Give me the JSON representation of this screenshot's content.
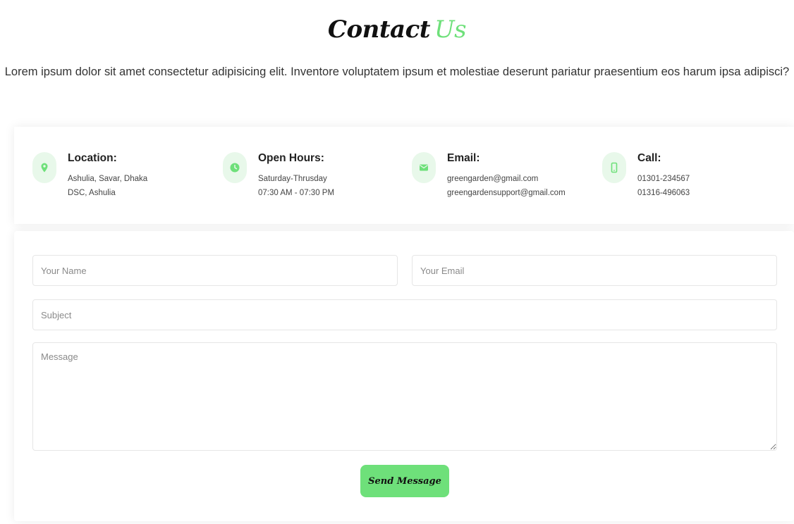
{
  "header": {
    "title_main": "Contact",
    "title_accent": "Us",
    "intro": "Lorem ipsum dolor sit amet consectetur adipisicing elit. Inventore voluptatem ipsum et molestiae deserunt pariatur praesentium eos harum ipsa adipisci?"
  },
  "info": [
    {
      "icon": "map-pin-icon",
      "title": "Location:",
      "lines": [
        "Ashulia, Savar, Dhaka",
        "DSC, Ashulia"
      ]
    },
    {
      "icon": "clock-icon",
      "title": "Open Hours:",
      "lines": [
        "Saturday-Thrusday",
        "07:30 AM - 07:30 PM"
      ]
    },
    {
      "icon": "envelope-icon",
      "title": "Email:",
      "lines": [
        "greengarden@gmail.com",
        "greengardensupport@gmail.com"
      ]
    },
    {
      "icon": "mobile-phone-icon",
      "title": "Call:",
      "lines": [
        "01301-234567",
        "01316-496063"
      ]
    }
  ],
  "form": {
    "name_placeholder": "Your Name",
    "email_placeholder": "Your Email",
    "subject_placeholder": "Subject",
    "message_placeholder": "Message",
    "submit_label": "Send Message"
  },
  "colors": {
    "accent": "#6ee07a",
    "icon_bg": "#e8f8ea"
  }
}
